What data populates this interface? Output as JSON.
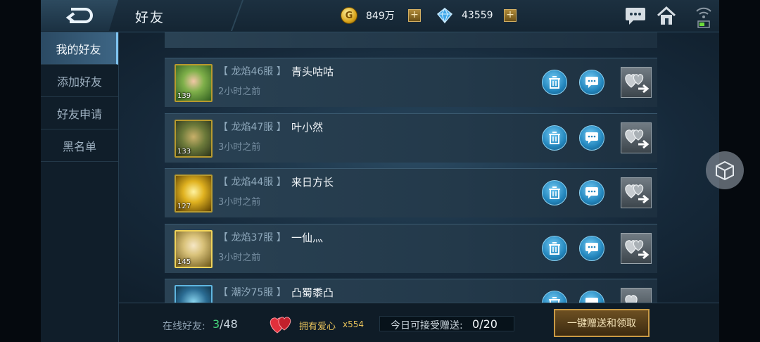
{
  "header": {
    "title": "好友",
    "gold": {
      "icon": "gold-coin-icon",
      "symbol": "G",
      "value": "849万"
    },
    "diamond": {
      "icon": "diamond-icon",
      "value": "43559"
    },
    "plus": "+"
  },
  "sidebar": {
    "items": [
      {
        "label": "我的好友",
        "active": true
      },
      {
        "label": "添加好友",
        "active": false
      },
      {
        "label": "好友申请",
        "active": false
      },
      {
        "label": "黑名单",
        "active": false
      }
    ]
  },
  "friends": [
    {
      "server": "【 龙焰46服 】",
      "name": "青头咕咕",
      "time": "2小时之前",
      "level": "139"
    },
    {
      "server": "【 龙焰47服 】",
      "name": "叶小然",
      "time": "3小时之前",
      "level": "133"
    },
    {
      "server": "【 龙焰44服 】",
      "name": "来日方长",
      "time": "3小时之前",
      "level": "127"
    },
    {
      "server": "【 龙焰37服 】",
      "name": "一仙灬",
      "time": "3小时之前",
      "level": "145"
    },
    {
      "server": "【 潮汐75服 】",
      "name": "凸蜀黍凸",
      "time": "",
      "level": ""
    }
  ],
  "footer": {
    "online_label": "在线好友:",
    "online_count": "3",
    "online_total": "/48",
    "love_label": "拥有爱心",
    "love_count": "x554",
    "receive_label": "今日可接受赠送:",
    "receive_value": "0/20",
    "claim_button": "一键赠送和领取"
  }
}
